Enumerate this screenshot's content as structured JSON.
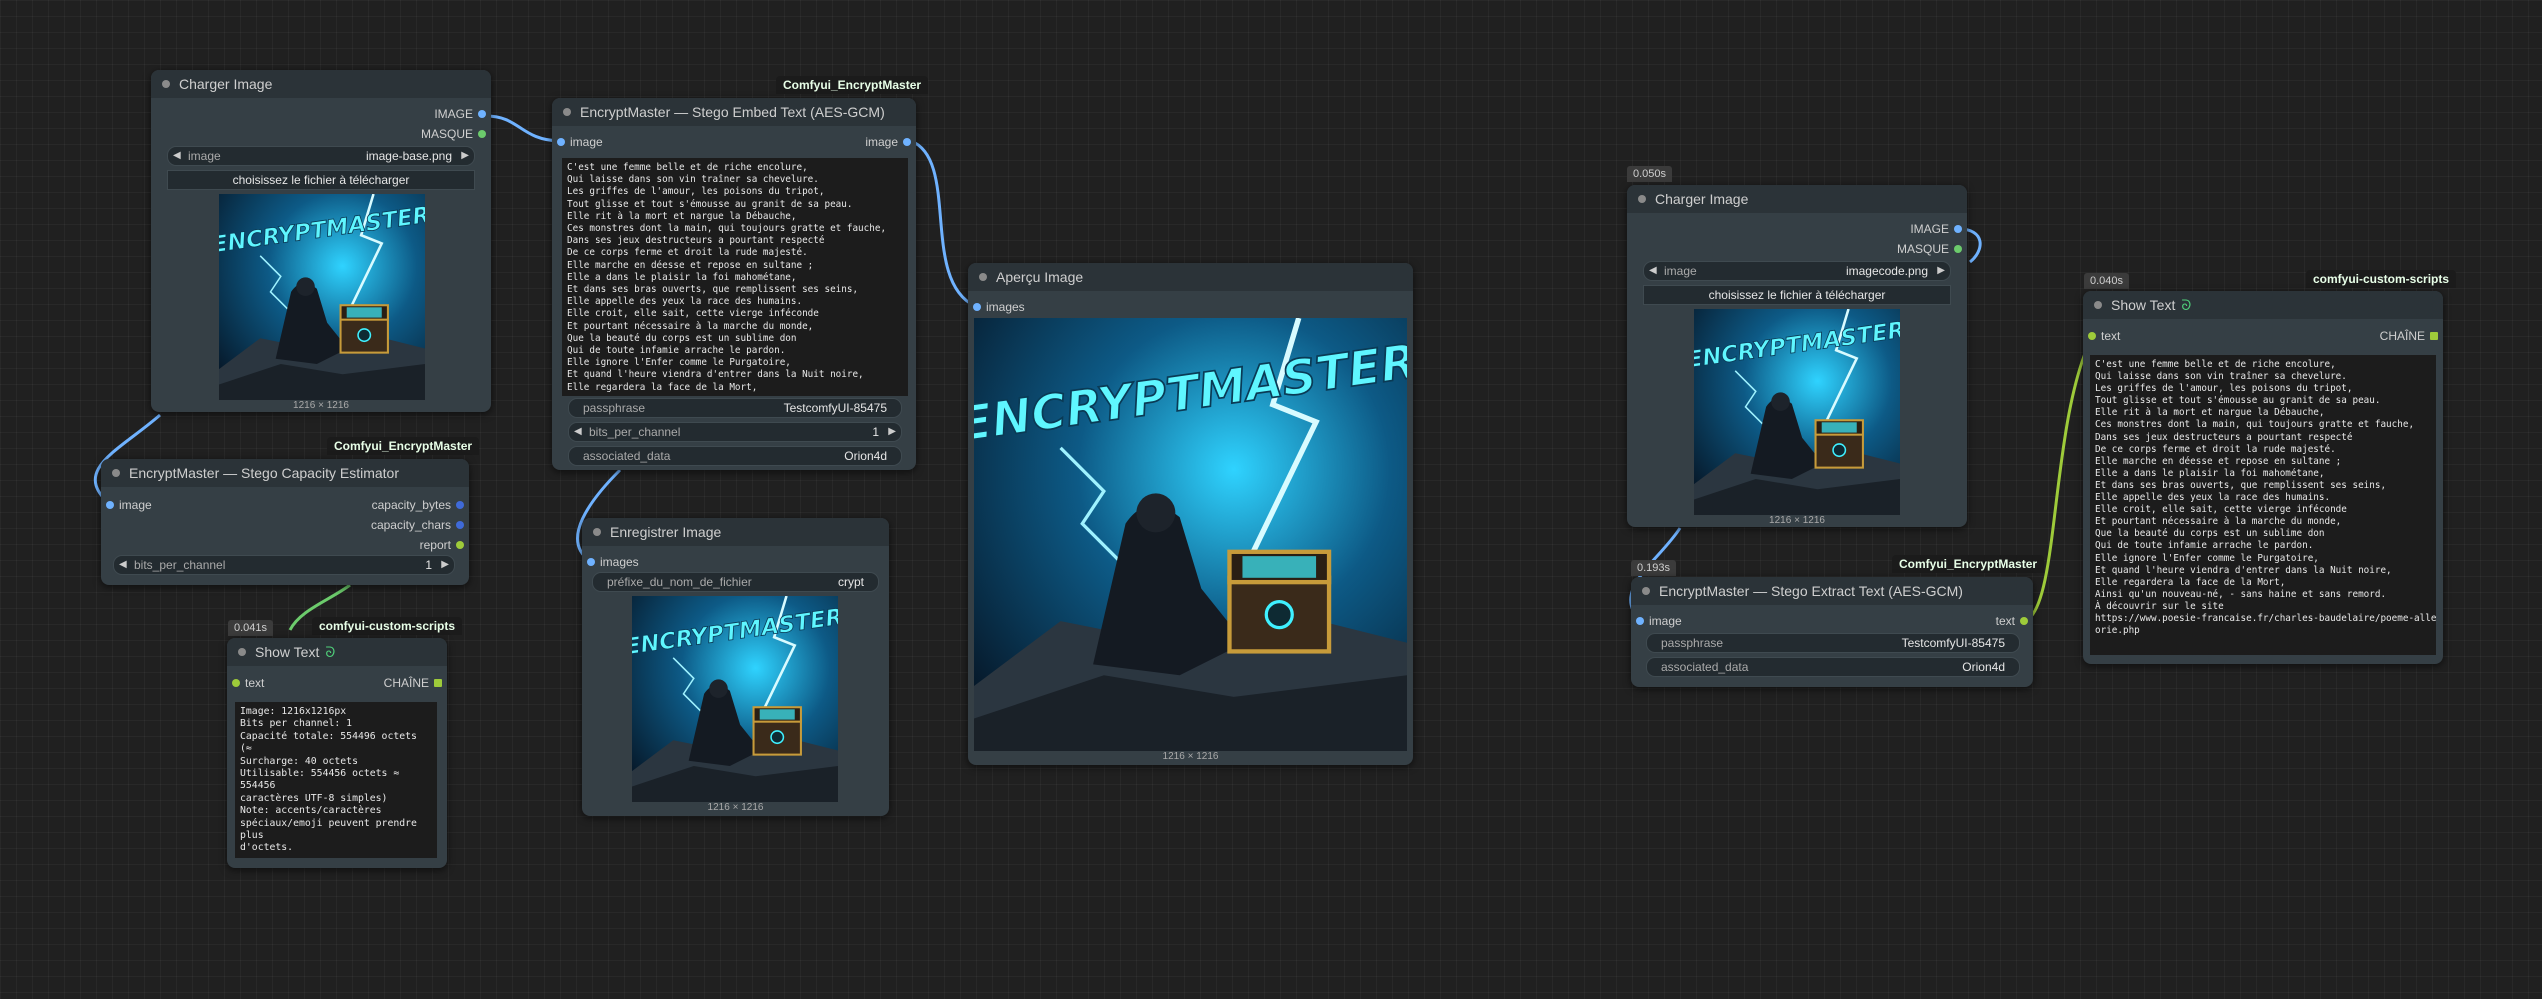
{
  "colors": {
    "image_port": "#6fb2ff",
    "mask_port": "#6ccb6c",
    "string_port": "#9ecb3a",
    "int_port": "#3f6ad8",
    "node_bg": "#353f45"
  },
  "nodes": {
    "load1": {
      "title": "Charger Image",
      "out_image": "IMAGE",
      "out_mask": "MASQUE",
      "combo_label": "image",
      "combo_value": "image-base.png",
      "upload": "choisissez le fichier à télécharger",
      "dims": "1216 × 1216"
    },
    "embed": {
      "badge": "Comfyui_EncryptMaster",
      "title": "EncryptMaster — Stego Embed Text (AES-GCM)",
      "in_image": "image",
      "out_image": "image",
      "text": "C'est une femme belle et de riche encolure,\nQui laisse dans son vin traîner sa chevelure.\nLes griffes de l'amour, les poisons du tripot,\nTout glisse et tout s'émousse au granit de sa peau.\nElle rit à la mort et nargue la Débauche,\nCes monstres dont la main, qui toujours gratte et fauche,\nDans ses jeux destructeurs a pourtant respecté\nDe ce corps ferme et droit la rude majesté.\nElle marche en déesse et repose en sultane ;\nElle a dans le plaisir la foi mahométane,\nEt dans ses bras ouverts, que remplissent ses seins,\nElle appelle des yeux la race des humains.\nElle croit, elle sait, cette vierge inféconde\nEt pourtant nécessaire à la marche du monde,\nQue la beauté du corps est un sublime don\nQui de toute infamie arrache le pardon.\nElle ignore l'Enfer comme le Purgatoire,\nEt quand l'heure viendra d'entrer dans la Nuit noire,\nElle regardera la face de la Mort,",
      "passphrase_label": "passphrase",
      "passphrase_value": "TestcomfyUI-85475",
      "bits_label": "bits_per_channel",
      "bits_value": "1",
      "assoc_label": "associated_data",
      "assoc_value": "Orion4d"
    },
    "capacity": {
      "badge": "Comfyui_EncryptMaster",
      "title": "EncryptMaster — Stego Capacity Estimator",
      "in_image": "image",
      "out_bytes": "capacity_bytes",
      "out_chars": "capacity_chars",
      "out_report": "report",
      "bits_label": "bits_per_channel",
      "bits_value": "1"
    },
    "show1": {
      "timer": "0.041s",
      "badge": "comfyui-custom-scripts",
      "title": "Show Text",
      "in_text": "text",
      "out_chain": "CHAÎNE",
      "text": "Image: 1216x1216px\nBits per channel: 1\nCapacité totale: 554496 octets (≈\nSurcharge: 40 octets\nUtilisable: 554456 octets ≈ 554456\ncaractères UTF-8 simples)\nNote: accents/caractères\nspéciaux/emoji peuvent prendre plus\nd'octets."
    },
    "preview": {
      "title": "Aperçu Image",
      "in_images": "images",
      "dims": "1216 × 1216"
    },
    "save": {
      "title": "Enregistrer Image",
      "in_images": "images",
      "prefix_label": "préfixe_du_nom_de_fichier",
      "prefix_value": "crypt",
      "dims": "1216 × 1216"
    },
    "load2": {
      "timer": "0.050s",
      "title": "Charger Image",
      "out_image": "IMAGE",
      "out_mask": "MASQUE",
      "combo_label": "image",
      "combo_value": "imagecode.png",
      "upload": "choisissez le fichier à télécharger",
      "dims": "1216 × 1216"
    },
    "extract": {
      "timer": "0.193s",
      "badge": "Comfyui_EncryptMaster",
      "title": "EncryptMaster — Stego Extract Text (AES-GCM)",
      "in_image": "image",
      "out_text": "text",
      "passphrase_label": "passphrase",
      "passphrase_value": "TestcomfyUI-85475",
      "assoc_label": "associated_data",
      "assoc_value": "Orion4d"
    },
    "show2": {
      "timer": "0.040s",
      "badge": "comfyui-custom-scripts",
      "title": "Show Text",
      "in_text": "text",
      "out_chain": "CHAÎNE",
      "text": "C'est une femme belle et de riche encolure,\nQui laisse dans son vin traîner sa chevelure.\nLes griffes de l'amour, les poisons du tripot,\nTout glisse et tout s'émousse au granit de sa peau.\nElle rit à la mort et nargue la Débauche,\nCes monstres dont la main, qui toujours gratte et fauche,\nDans ses jeux destructeurs a pourtant respecté\nDe ce corps ferme et droit la rude majesté.\nElle marche en déesse et repose en sultane ;\nElle a dans le plaisir la foi mahométane,\nEt dans ses bras ouverts, que remplissent ses seins,\nElle appelle des yeux la race des humains.\nElle croit, elle sait, cette vierge inféconde\nEt pourtant nécessaire à la marche du monde,\nQue la beauté du corps est un sublime don\nQui de toute infamie arrache le pardon.\nElle ignore l'Enfer comme le Purgatoire,\nEt quand l'heure viendra d'entrer dans la Nuit noire,\nElle regardera la face de la Mort,\nAinsi qu'un nouveau-né, - sans haine et sans remord.\nÀ découvrir sur le site\nhttps://www.poesie-francaise.fr/charles-baudelaire/poeme-alleg\norie.php"
    }
  },
  "artwork": {
    "title_text": "ENCRYPTMASTER"
  }
}
